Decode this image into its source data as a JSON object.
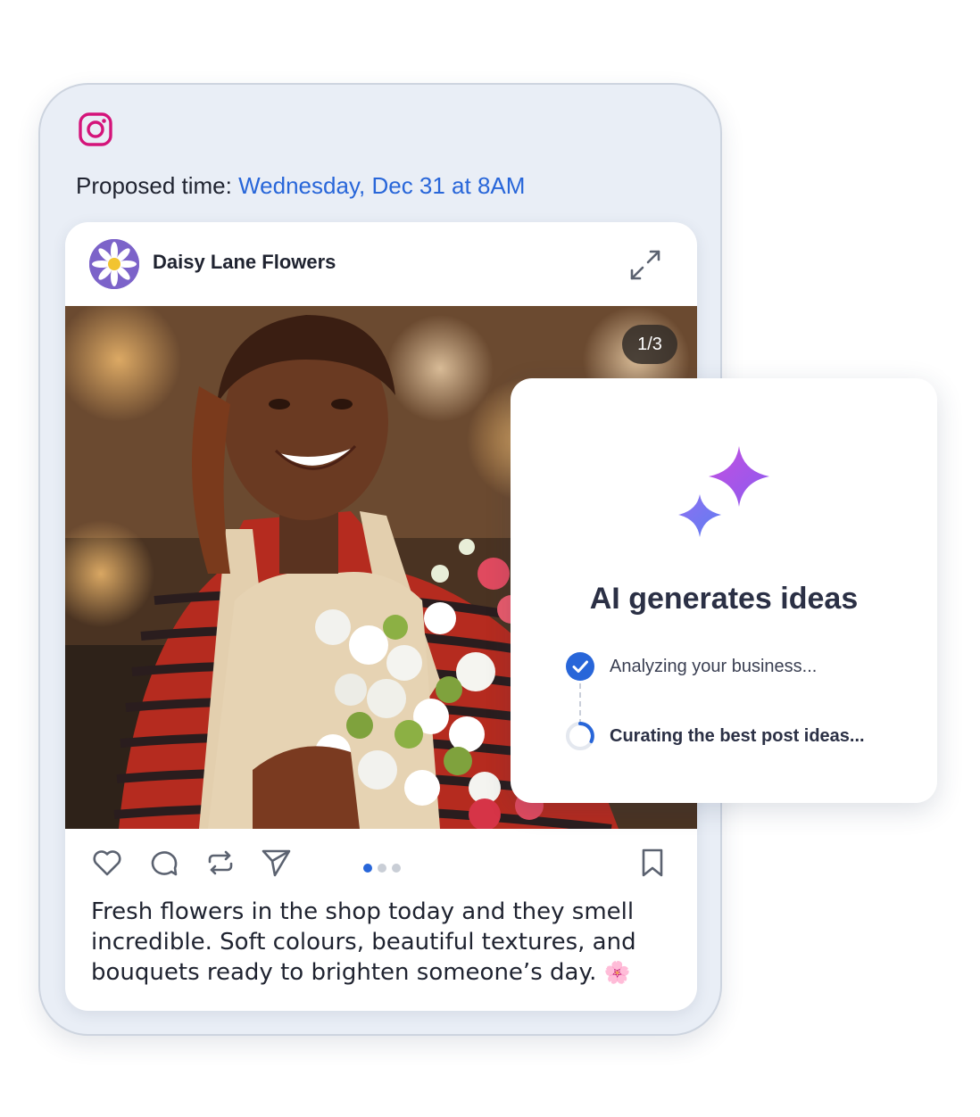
{
  "post_preview": {
    "platform_icon": "instagram-icon",
    "proposed_label": "Proposed time:",
    "proposed_time": "Wednesday, Dec 31 at 8AM",
    "profile_name": "Daisy Lane Flowers",
    "image_counter": "1/3",
    "carousel": {
      "current": 1,
      "total": 3
    },
    "action_icons": [
      "heart-icon",
      "comment-icon",
      "repost-icon",
      "send-icon",
      "bookmark-icon"
    ],
    "caption": "Fresh flowers in the shop today and they smell incredible. Soft colours, beautiful textures, and bouquets ready to brighten someone’s day.",
    "caption_emoji": "🌸"
  },
  "ai_panel": {
    "title": "AI generates ideas",
    "steps": [
      {
        "label": "Analyzing your business...",
        "status": "done"
      },
      {
        "label": "Curating the best post ideas...",
        "status": "in-progress"
      }
    ]
  },
  "colors": {
    "accent_blue": "#2866d9",
    "instagram_pink": "#d4147a",
    "sparkle_purple": "#a24ee0",
    "sparkle_blue": "#6c7cf2"
  }
}
